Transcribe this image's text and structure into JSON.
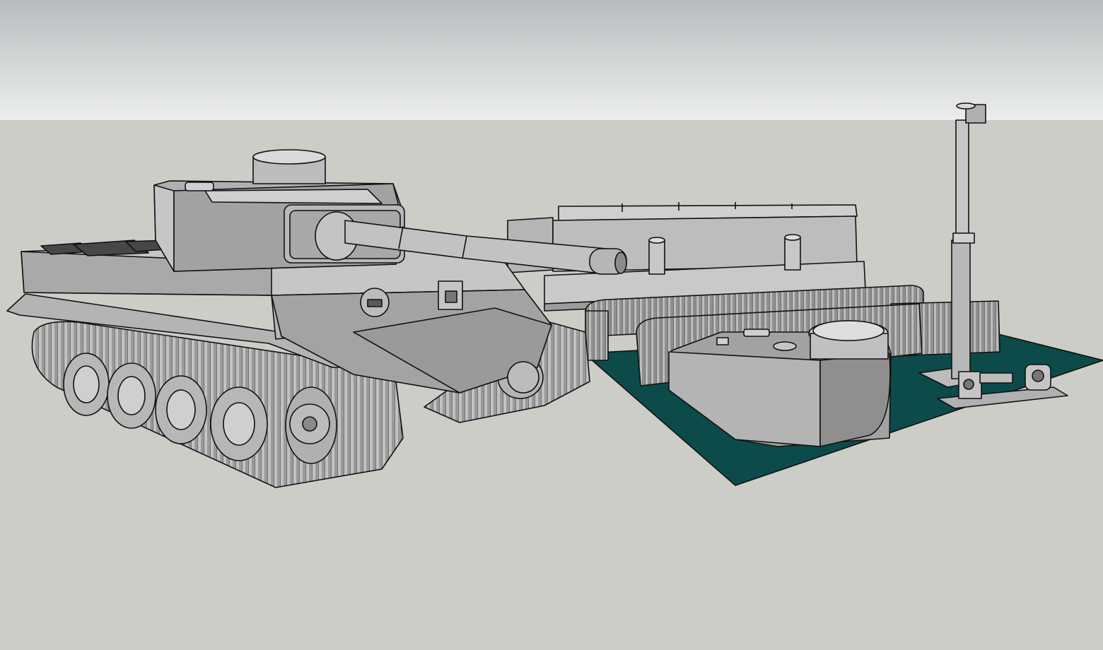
{
  "viewport": {
    "sky_top_color": "#b9bcbe",
    "sky_bottom_color": "#eceeee",
    "ground_color": "#cccdc7",
    "base_plate_color": "#0d4a4a",
    "model_face_light": "#c4c4c4",
    "model_face_mid": "#a6a6a6",
    "model_face_dark": "#8a8a8a",
    "edge_color": "#111111"
  },
  "scene": {
    "assembled_model": "tank",
    "parts_layout": [
      "hull",
      "tracks",
      "turret",
      "gun-barrel",
      "gun-mount",
      "fenders"
    ]
  }
}
